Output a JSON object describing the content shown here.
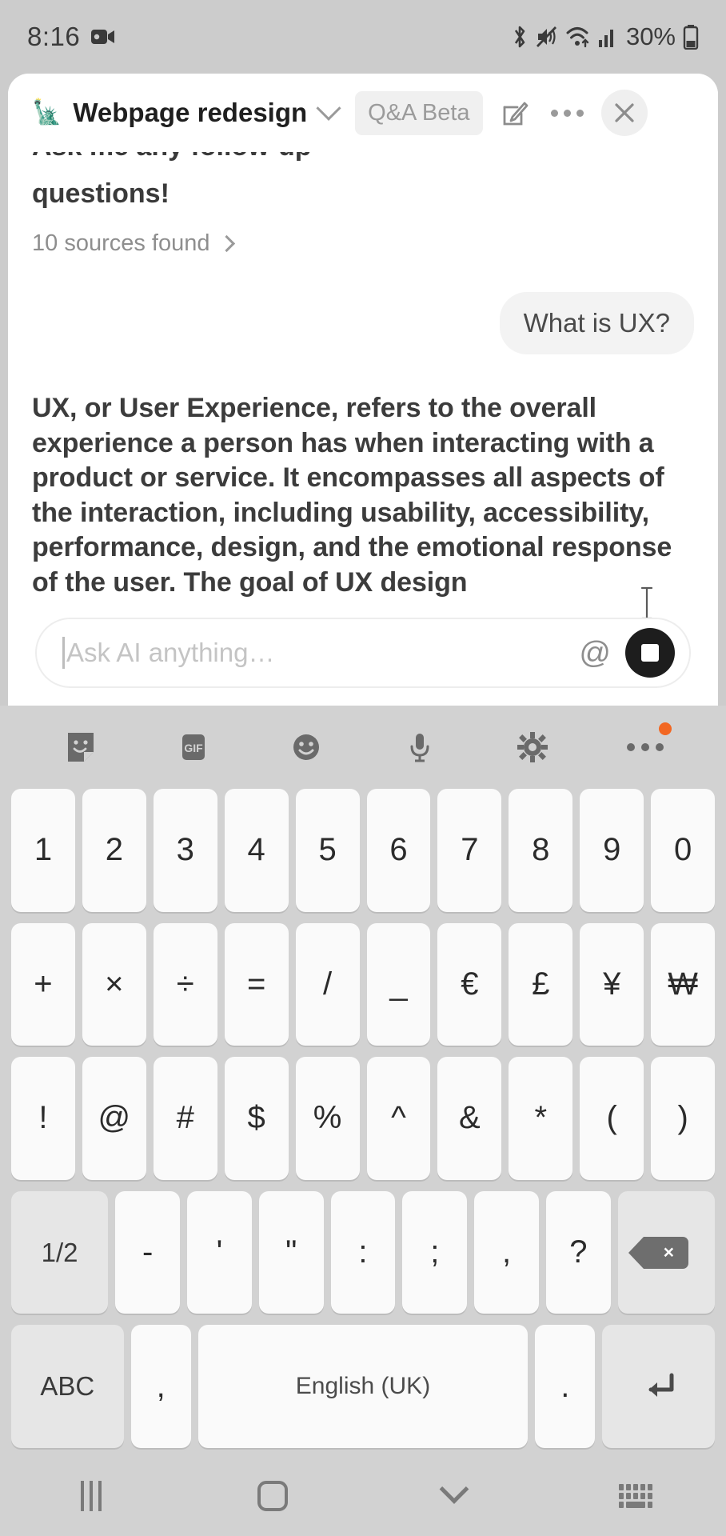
{
  "status_bar": {
    "time": "8:16",
    "battery_percent": "30%",
    "icons": [
      "video-recording-icon",
      "bluetooth-icon",
      "mute-vibrate-icon",
      "wifi-icon",
      "cellular-signal-icon",
      "battery-icon"
    ]
  },
  "app": {
    "emoji": "🗽",
    "title": "Webpage redesign",
    "badge": "Q&A Beta",
    "icons": {
      "chevron": "chevron-down-icon",
      "compose": "compose-icon",
      "more": "more-options-icon",
      "close": "close-icon"
    }
  },
  "conversation": {
    "clipped_line": "Ask me any follow-up",
    "continued_line": "questions!",
    "sources_label": "10 sources found",
    "user_message": "What is UX?",
    "assistant_message": "UX, or User Experience, refers to the overall experience a person has when interacting with a product or service. It encompasses all aspects of the interaction, including usability, accessibility, performance, design, and the emotional response of the user. The goal of UX design"
  },
  "composer": {
    "placeholder": "Ask AI anything…",
    "value": "",
    "mention_icon": "at-mention-icon",
    "stop_icon": "stop-generating-icon"
  },
  "keyboard": {
    "toolbar": [
      {
        "name": "sticker-icon",
        "label": ""
      },
      {
        "name": "gif-icon",
        "label": "GIF"
      },
      {
        "name": "emoji-icon",
        "label": ""
      },
      {
        "name": "microphone-icon",
        "label": ""
      },
      {
        "name": "settings-gear-icon",
        "label": ""
      },
      {
        "name": "more-options-icon",
        "label": ""
      }
    ],
    "rows": [
      [
        "1",
        "2",
        "3",
        "4",
        "5",
        "6",
        "7",
        "8",
        "9",
        "0"
      ],
      [
        "+",
        "×",
        "÷",
        "=",
        "/",
        "_",
        "€",
        "£",
        "¥",
        "₩"
      ],
      [
        "!",
        "@",
        "#",
        "$",
        "%",
        "^",
        "&",
        "*",
        "(",
        ")"
      ],
      [
        "1/2",
        "-",
        "'",
        "\"",
        ":",
        ";",
        ",",
        "?",
        "backspace-icon"
      ],
      [
        "ABC",
        ",",
        "English (UK)",
        ".",
        "enter-icon"
      ]
    ],
    "page_key": "1/2",
    "abc_key": "ABC",
    "space_key": "English (UK)",
    "backspace": "backspace-icon",
    "enter": "enter-icon"
  },
  "nav_bar": {
    "recents": "recents-icon",
    "home": "home-icon",
    "hide_keyboard": "chevron-down-icon",
    "keyboard_switch": "keyboard-switch-icon"
  },
  "colors": {
    "system_gray": "#d2d2d2",
    "card_white": "#ffffff",
    "badge_orange": "#f26722",
    "stop_black": "#1d1d1d"
  }
}
